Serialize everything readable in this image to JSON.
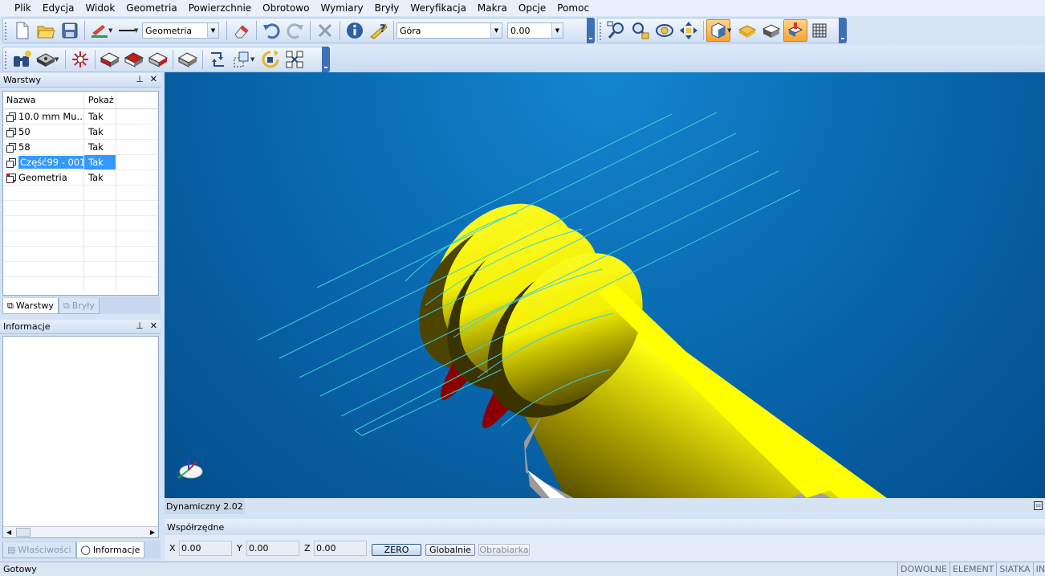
{
  "menu": [
    "Plik",
    "Edycja",
    "Widok",
    "Geometria",
    "Powierzchnie",
    "Obrotowo",
    "Wymiary",
    "Bryły",
    "Weryfikacja",
    "Makra",
    "Opcje",
    "Pomoc"
  ],
  "toolbar": {
    "level_combo": "Geometria",
    "view_combo": "Góra",
    "depth_combo": "0.00"
  },
  "layers_panel": {
    "title": "Warstwy",
    "col_name": "Nazwa",
    "col_show": "Pokaż",
    "rows": [
      {
        "name": "10.0 mm Mu...",
        "show": "Tak"
      },
      {
        "name": "50",
        "show": "Tak"
      },
      {
        "name": "58",
        "show": "Tak"
      },
      {
        "name": "Część99 - 001",
        "show": "Tak"
      },
      {
        "name": "Geometria",
        "show": "Tak"
      }
    ],
    "tab_layers": "Warstwy",
    "tab_solids": "Bryły"
  },
  "info_panel": {
    "title": "Informacje",
    "tab_properties": "Właściwości",
    "tab_info": "Informacje"
  },
  "viewport": {
    "mode_label": "Dynamiczny 2.02"
  },
  "coords": {
    "title": "Współrzędne",
    "x_label": "X",
    "x_value": "0.00",
    "y_label": "Y",
    "y_value": "0.00",
    "z_label": "Z",
    "z_value": "0.00",
    "zero_btn": "ZERO",
    "global_btn": "Globalnie",
    "machine_btn": "Obrabiarka"
  },
  "status": {
    "text": "Gotowy",
    "indicators": [
      "DOWOLNE",
      "ELEMENT",
      "SIATKA",
      "INS"
    ]
  },
  "colors": {
    "viewport_bg": "#0a6db4",
    "part_yellow": "#ffff00",
    "groove_red": "#a00000",
    "toolpath_cyan": "#3fd0d8",
    "selection": "#3399ff"
  }
}
